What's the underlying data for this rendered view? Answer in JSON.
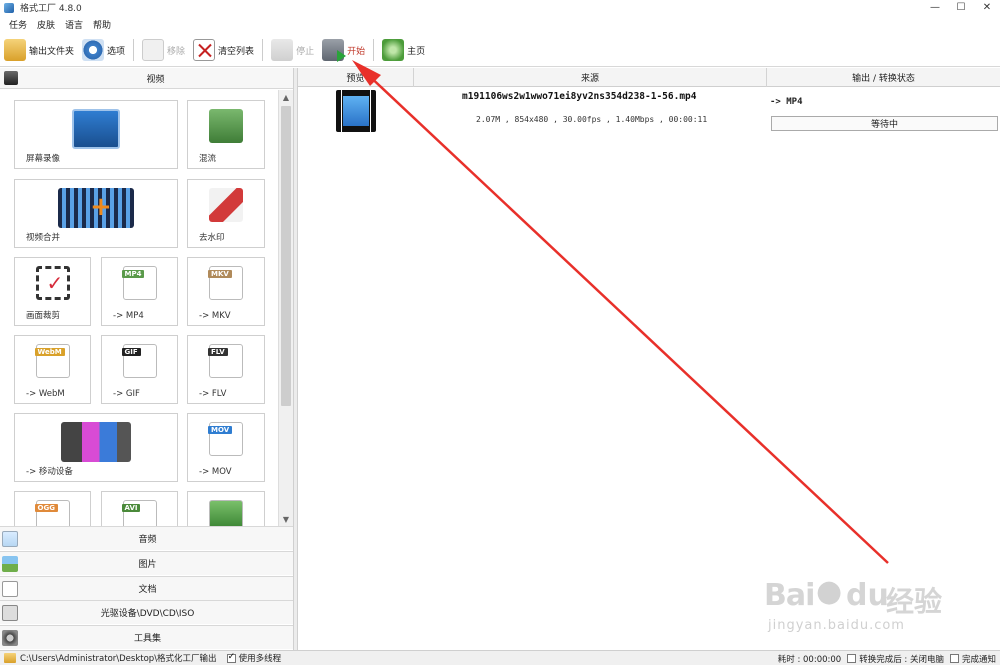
{
  "window": {
    "title": "格式工厂 4.8.0",
    "controls": [
      "—",
      "☐",
      "✕"
    ]
  },
  "menu": [
    "任务",
    "皮肤",
    "语言",
    "帮助"
  ],
  "toolbar": {
    "output_folder": "输出文件夹",
    "options": "选项",
    "remove": "移除",
    "clear_list": "清空列表",
    "stop": "停止",
    "start": "开始",
    "home": "主页"
  },
  "left_panel": {
    "active_category": "视频",
    "tiles": [
      {
        "label": "屏幕录像",
        "icon": "screen-record-icon"
      },
      {
        "label": "混流",
        "icon": "mux-icon"
      },
      {
        "label": "视频合并",
        "icon": "video-merge-icon"
      },
      {
        "label": "去水印",
        "icon": "remove-watermark-icon"
      },
      {
        "label": "画面裁剪",
        "icon": "crop-icon"
      },
      {
        "label": "-> MP4",
        "icon": "mp4-file-icon",
        "tag": "MP4"
      },
      {
        "label": "-> MKV",
        "icon": "mkv-file-icon",
        "tag": "MKV"
      },
      {
        "label": "-> WebM",
        "icon": "webm-file-icon",
        "tag": "WebM"
      },
      {
        "label": "-> GIF",
        "icon": "gif-file-icon",
        "tag": "GIF"
      },
      {
        "label": "-> FLV",
        "icon": "flv-file-icon",
        "tag": "FLV"
      },
      {
        "label": "-> 移动设备",
        "icon": "mobile-device-icon"
      },
      {
        "label": "-> MOV",
        "icon": "mov-file-icon",
        "tag": "MOV"
      },
      {
        "label": "",
        "icon": "ogg-file-icon",
        "tag": "OGG"
      },
      {
        "label": "",
        "icon": "avi-file-icon",
        "tag": "AVI"
      },
      {
        "label": "",
        "icon": "wmv-file-icon"
      }
    ],
    "categories": [
      "音频",
      "图片",
      "文档",
      "光驱设备\\DVD\\CD\\ISO",
      "工具集"
    ]
  },
  "task_list": {
    "columns": [
      "预览",
      "来源",
      "输出 / 转换状态"
    ],
    "rows": [
      {
        "filename": "m191106ws2w1wwo71ei8yv2ns354d238-1-56.mp4",
        "info": "2.07M , 854x480 , 30.00fps , 1.40Mbps , 00:00:11",
        "output_format": "-> MP4",
        "status": "等待中"
      }
    ]
  },
  "watermark": {
    "brand_left": "Bai",
    "brand_mid": "du",
    "brand_right": "经验",
    "url": "jingyan.baidu.com"
  },
  "statusbar": {
    "output_path": "C:\\Users\\Administrator\\Desktop\\格式化工厂输出",
    "multithread_label": "使用多线程",
    "multithread_checked": true,
    "elapsed": "耗时 : 00:00:00",
    "after_convert_label": "转换完成后 : 关闭电脑",
    "after_convert_checked": false,
    "notify_label": "完成通知",
    "notify_checked": false
  },
  "colors": {
    "annotation_arrow": "#e8302a",
    "start_label": "#c0392b"
  }
}
